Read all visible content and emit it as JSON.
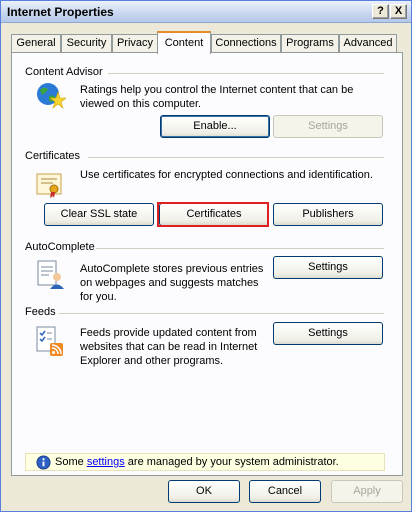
{
  "window": {
    "title": "Internet Properties",
    "help_label": "?",
    "close_label": "X"
  },
  "tabs": [
    {
      "label": "General"
    },
    {
      "label": "Security"
    },
    {
      "label": "Privacy"
    },
    {
      "label": "Content"
    },
    {
      "label": "Connections"
    },
    {
      "label": "Programs"
    },
    {
      "label": "Advanced"
    }
  ],
  "active_tab": "Content",
  "content_advisor": {
    "title": "Content Advisor",
    "description_line1": "Ratings help you control the Internet content that can be",
    "description_line2": "viewed on this computer.",
    "enable_label": "Enable...",
    "settings_label": "Settings",
    "icon": "globe-star-icon"
  },
  "certificates": {
    "title": "Certificates",
    "description": "Use certificates for encrypted connections and identification.",
    "clear_ssl_label": "Clear SSL state",
    "certificates_label": "Certificates",
    "publishers_label": "Publishers",
    "icon": "certificate-icon"
  },
  "autocomplete": {
    "title": "AutoComplete",
    "description_line1": "AutoComplete stores previous entries",
    "description_line2": "on webpages and suggests matches",
    "description_line3": "for you.",
    "settings_label": "Settings",
    "icon": "autocomplete-icon"
  },
  "feeds": {
    "title": "Feeds",
    "description_line1": "Feeds provide updated content from",
    "description_line2": "websites that can be read in Internet",
    "description_line3": "Explorer and other programs.",
    "settings_label": "Settings",
    "icon": "feed-icon"
  },
  "info_bar": {
    "prefix": "Some",
    "link": "settings",
    "suffix": "are managed by your system administrator.",
    "icon": "info-icon"
  },
  "footer": {
    "ok_label": "OK",
    "cancel_label": "Cancel",
    "apply_label": "Apply"
  },
  "colors": {
    "highlight": "#e02020",
    "link": "#0000ff",
    "accent": "#e68b2c"
  }
}
